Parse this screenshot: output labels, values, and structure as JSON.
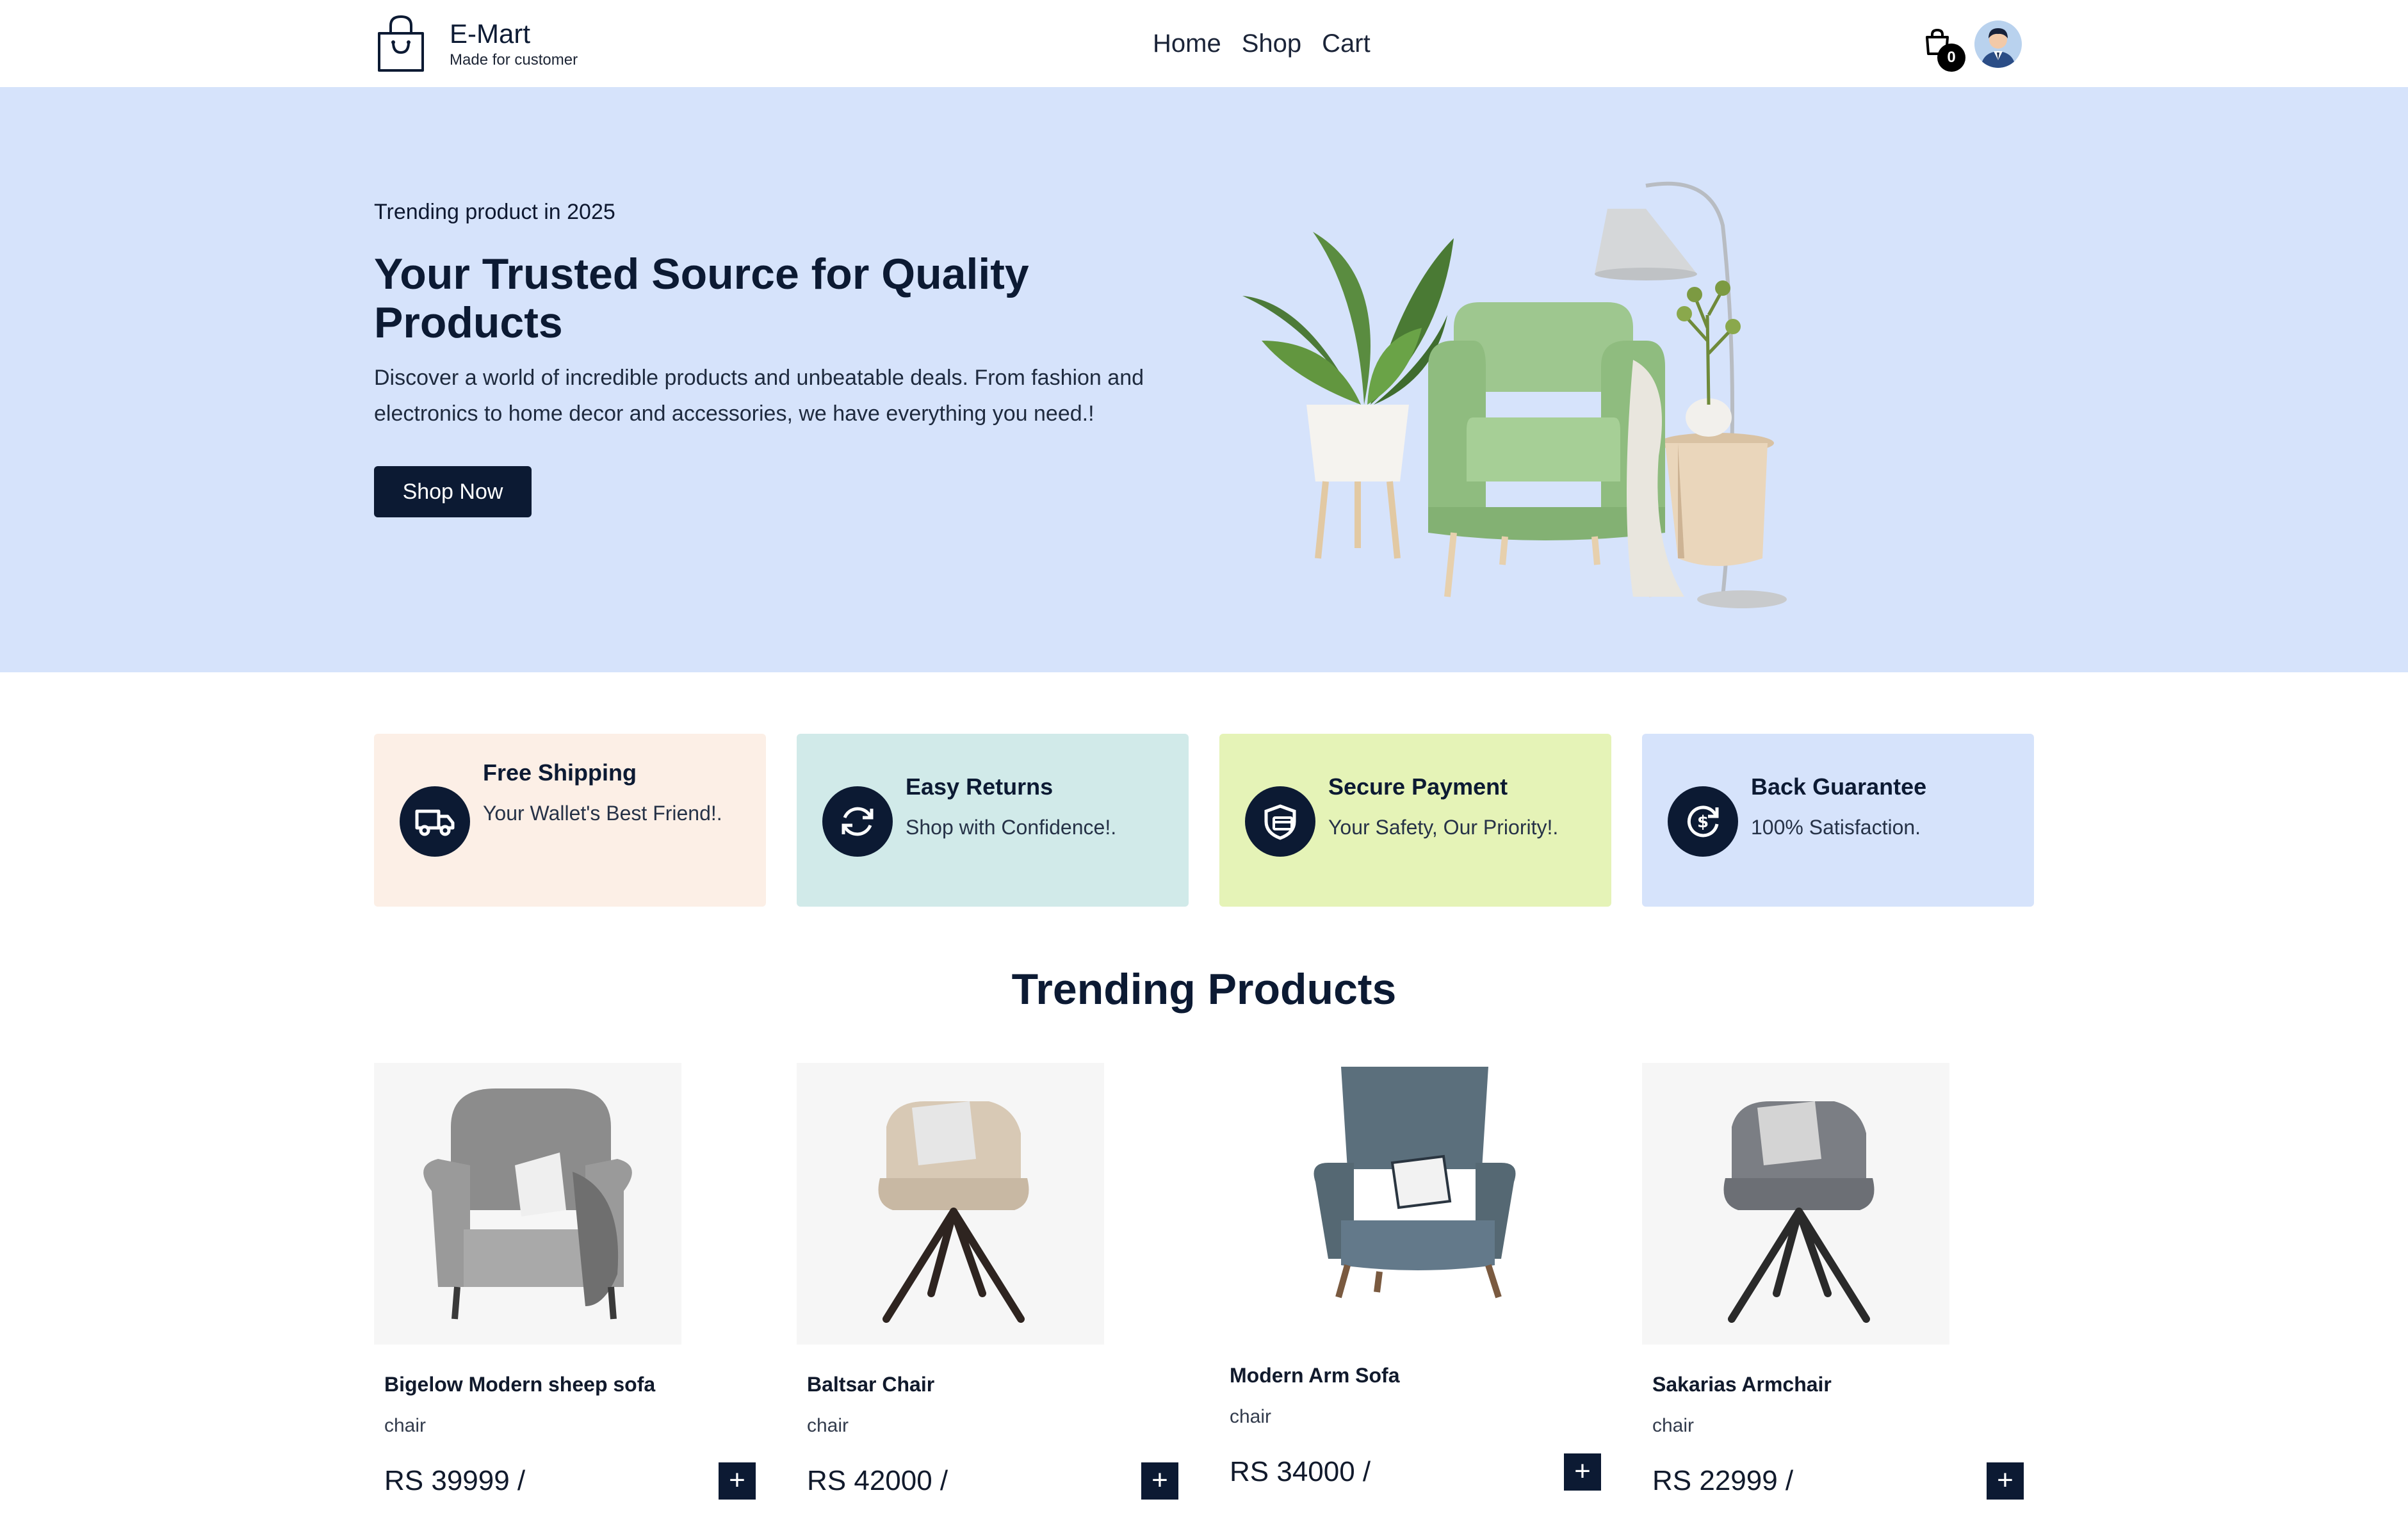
{
  "brand": {
    "name": "E-Mart",
    "tagline": "Made for customer"
  },
  "nav": {
    "items": [
      "Home",
      "Shop",
      "Cart"
    ]
  },
  "cart": {
    "count": "0"
  },
  "hero": {
    "eyebrow": "Trending product in 2025",
    "title": "Your Trusted Source for Quality Products",
    "description": "Discover a world of incredible products and unbeatable deals. From fashion and electronics to home decor and accessories, we have everything you need.!",
    "button": "Shop Now"
  },
  "features": [
    {
      "title": "Free Shipping",
      "text": "Your Wallet's Best Friend!.",
      "icon": "truck-icon",
      "bg": "#fcefe6"
    },
    {
      "title": "Easy Returns",
      "text": "Shop with Confidence!.",
      "icon": "refresh-icon",
      "bg": "#d1eae9"
    },
    {
      "title": "Secure Payment",
      "text": "Your Safety, Our Priority!.",
      "icon": "shield-card-icon",
      "bg": "#e5f3b7"
    },
    {
      "title": "Back Guarantee",
      "text": "100% Satisfaction.",
      "icon": "money-back-icon",
      "bg": "#d6e3fb"
    }
  ],
  "trending": {
    "title": "Trending Products",
    "products": [
      {
        "name": "Bigelow Modern sheep sofa",
        "category": "chair",
        "price": "RS 39999 /",
        "add": "+"
      },
      {
        "name": "Baltsar Chair",
        "category": "chair",
        "price": "RS 42000 /",
        "add": "+"
      },
      {
        "name": "Modern Arm Sofa",
        "category": "chair",
        "price": "RS 34000 /",
        "add": "+"
      },
      {
        "name": "Sakarias Armchair",
        "category": "chair",
        "price": "RS 22999 /",
        "add": "+"
      }
    ]
  },
  "colors": {
    "primary": "#0c1a33",
    "hero_bg": "#d6e3fb"
  }
}
